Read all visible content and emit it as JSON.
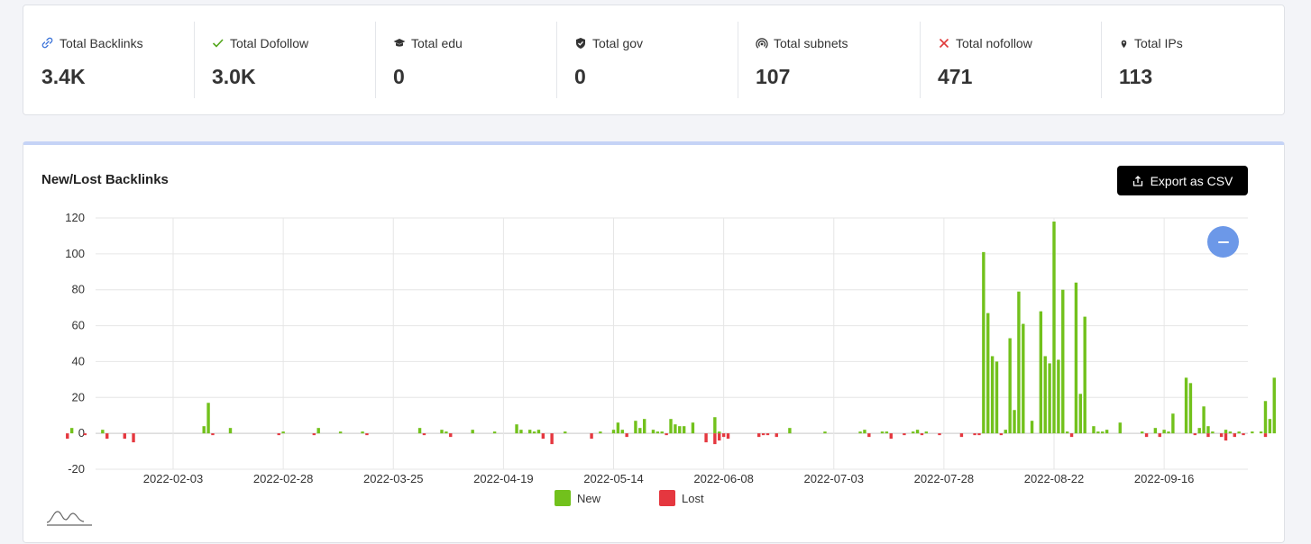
{
  "stats": [
    {
      "label": "Total Backlinks",
      "value": "3.4K",
      "icon": "link-icon",
      "color": "#3a72d8"
    },
    {
      "label": "Total Dofollow",
      "value": "3.0K",
      "icon": "check-icon",
      "color": "#52a61a"
    },
    {
      "label": "Total edu",
      "value": "0",
      "icon": "graduation-cap-icon",
      "color": "#333333"
    },
    {
      "label": "Total gov",
      "value": "0",
      "icon": "shield-check-icon",
      "color": "#333333"
    },
    {
      "label": "Total subnets",
      "value": "107",
      "icon": "broadcast-icon",
      "color": "#333333"
    },
    {
      "label": "Total nofollow",
      "value": "471",
      "icon": "cross-icon",
      "color": "#e03b3b"
    },
    {
      "label": "Total IPs",
      "value": "113",
      "icon": "map-pin-icon",
      "color": "#333333"
    }
  ],
  "chart": {
    "title": "New/Lost Backlinks",
    "export_label": "Export as CSV"
  },
  "chart_data": {
    "type": "bar",
    "title": "New/Lost Backlinks",
    "xlabel": "",
    "ylabel": "",
    "ylim": [
      -20,
      120
    ],
    "yticks": [
      -20,
      0,
      20,
      40,
      60,
      80,
      100,
      120
    ],
    "x_tick_labels": [
      "2022-02-03",
      "2022-02-28",
      "2022-03-25",
      "2022-04-19",
      "2022-05-14",
      "2022-06-08",
      "2022-07-03",
      "2022-07-28",
      "2022-08-22",
      "2022-09-16"
    ],
    "grid": true,
    "legend": "bottom",
    "colors": {
      "new": "#72c11c",
      "lost": "#e5373f"
    },
    "series": [
      {
        "name": "New",
        "values": [
          {
            "x": "2022-01-11",
            "y": 3
          },
          {
            "x": "2022-01-18",
            "y": 2
          },
          {
            "x": "2022-02-10",
            "y": 4
          },
          {
            "x": "2022-02-11",
            "y": 17
          },
          {
            "x": "2022-02-16",
            "y": 3
          },
          {
            "x": "2022-02-28",
            "y": 1
          },
          {
            "x": "2022-03-08",
            "y": 3
          },
          {
            "x": "2022-03-13",
            "y": 1
          },
          {
            "x": "2022-03-18",
            "y": 1
          },
          {
            "x": "2022-03-31",
            "y": 3
          },
          {
            "x": "2022-04-05",
            "y": 2
          },
          {
            "x": "2022-04-06",
            "y": 1
          },
          {
            "x": "2022-04-12",
            "y": 2
          },
          {
            "x": "2022-04-17",
            "y": 1
          },
          {
            "x": "2022-04-22",
            "y": 5
          },
          {
            "x": "2022-04-23",
            "y": 2
          },
          {
            "x": "2022-04-25",
            "y": 2
          },
          {
            "x": "2022-04-26",
            "y": 1
          },
          {
            "x": "2022-04-27",
            "y": 2
          },
          {
            "x": "2022-05-03",
            "y": 1
          },
          {
            "x": "2022-05-11",
            "y": 1
          },
          {
            "x": "2022-05-14",
            "y": 2
          },
          {
            "x": "2022-05-15",
            "y": 6
          },
          {
            "x": "2022-05-16",
            "y": 2
          },
          {
            "x": "2022-05-19",
            "y": 7
          },
          {
            "x": "2022-05-20",
            "y": 3
          },
          {
            "x": "2022-05-21",
            "y": 8
          },
          {
            "x": "2022-05-23",
            "y": 2
          },
          {
            "x": "2022-05-24",
            "y": 1
          },
          {
            "x": "2022-05-25",
            "y": 1
          },
          {
            "x": "2022-05-27",
            "y": 8
          },
          {
            "x": "2022-05-28",
            "y": 5
          },
          {
            "x": "2022-05-29",
            "y": 4
          },
          {
            "x": "2022-05-30",
            "y": 4
          },
          {
            "x": "2022-06-01",
            "y": 6
          },
          {
            "x": "2022-06-06",
            "y": 9
          },
          {
            "x": "2022-06-07",
            "y": 1
          },
          {
            "x": "2022-06-23",
            "y": 3
          },
          {
            "x": "2022-07-01",
            "y": 1
          },
          {
            "x": "2022-07-09",
            "y": 1
          },
          {
            "x": "2022-07-10",
            "y": 2
          },
          {
            "x": "2022-07-14",
            "y": 1
          },
          {
            "x": "2022-07-15",
            "y": 1
          },
          {
            "x": "2022-07-21",
            "y": 1
          },
          {
            "x": "2022-07-22",
            "y": 2
          },
          {
            "x": "2022-07-24",
            "y": 1
          },
          {
            "x": "2022-08-06",
            "y": 101
          },
          {
            "x": "2022-08-07",
            "y": 67
          },
          {
            "x": "2022-08-08",
            "y": 43
          },
          {
            "x": "2022-08-09",
            "y": 40
          },
          {
            "x": "2022-08-11",
            "y": 2
          },
          {
            "x": "2022-08-12",
            "y": 53
          },
          {
            "x": "2022-08-13",
            "y": 13
          },
          {
            "x": "2022-08-14",
            "y": 79
          },
          {
            "x": "2022-08-15",
            "y": 61
          },
          {
            "x": "2022-08-17",
            "y": 7
          },
          {
            "x": "2022-08-19",
            "y": 68
          },
          {
            "x": "2022-08-20",
            "y": 43
          },
          {
            "x": "2022-08-21",
            "y": 39
          },
          {
            "x": "2022-08-22",
            "y": 118
          },
          {
            "x": "2022-08-23",
            "y": 41
          },
          {
            "x": "2022-08-24",
            "y": 80
          },
          {
            "x": "2022-08-25",
            "y": 1
          },
          {
            "x": "2022-08-27",
            "y": 84
          },
          {
            "x": "2022-08-28",
            "y": 22
          },
          {
            "x": "2022-08-29",
            "y": 65
          },
          {
            "x": "2022-08-31",
            "y": 4
          },
          {
            "x": "2022-09-01",
            "y": 1
          },
          {
            "x": "2022-09-02",
            "y": 1
          },
          {
            "x": "2022-09-03",
            "y": 2
          },
          {
            "x": "2022-09-06",
            "y": 6
          },
          {
            "x": "2022-09-11",
            "y": 1
          },
          {
            "x": "2022-09-14",
            "y": 3
          },
          {
            "x": "2022-09-16",
            "y": 2
          },
          {
            "x": "2022-09-17",
            "y": 1
          },
          {
            "x": "2022-09-18",
            "y": 11
          },
          {
            "x": "2022-09-21",
            "y": 31
          },
          {
            "x": "2022-09-22",
            "y": 28
          },
          {
            "x": "2022-09-24",
            "y": 3
          },
          {
            "x": "2022-09-25",
            "y": 15
          },
          {
            "x": "2022-09-26",
            "y": 4
          },
          {
            "x": "2022-09-27",
            "y": 1
          },
          {
            "x": "2022-09-30",
            "y": 2
          },
          {
            "x": "2022-10-01",
            "y": 1
          },
          {
            "x": "2022-10-03",
            "y": 1
          },
          {
            "x": "2022-10-06",
            "y": 1
          },
          {
            "x": "2022-10-08",
            "y": 1
          },
          {
            "x": "2022-10-09",
            "y": 18
          },
          {
            "x": "2022-10-10",
            "y": 8
          },
          {
            "x": "2022-10-11",
            "y": 31
          }
        ]
      },
      {
        "name": "Lost",
        "values": [
          {
            "x": "2022-01-10",
            "y": -3
          },
          {
            "x": "2022-01-14",
            "y": -1
          },
          {
            "x": "2022-01-19",
            "y": -3
          },
          {
            "x": "2022-01-23",
            "y": -3
          },
          {
            "x": "2022-01-25",
            "y": -5
          },
          {
            "x": "2022-02-12",
            "y": -1
          },
          {
            "x": "2022-02-27",
            "y": -1
          },
          {
            "x": "2022-03-07",
            "y": -1
          },
          {
            "x": "2022-03-19",
            "y": -1
          },
          {
            "x": "2022-04-01",
            "y": -1
          },
          {
            "x": "2022-04-07",
            "y": -2
          },
          {
            "x": "2022-04-28",
            "y": -3
          },
          {
            "x": "2022-04-30",
            "y": -6
          },
          {
            "x": "2022-05-09",
            "y": -3
          },
          {
            "x": "2022-05-17",
            "y": -2
          },
          {
            "x": "2022-05-26",
            "y": -1
          },
          {
            "x": "2022-06-04",
            "y": -5
          },
          {
            "x": "2022-06-06",
            "y": -6
          },
          {
            "x": "2022-06-07",
            "y": -4
          },
          {
            "x": "2022-06-08",
            "y": -2
          },
          {
            "x": "2022-06-09",
            "y": -3
          },
          {
            "x": "2022-06-16",
            "y": -2
          },
          {
            "x": "2022-06-17",
            "y": -1
          },
          {
            "x": "2022-06-18",
            "y": -1
          },
          {
            "x": "2022-06-20",
            "y": -2
          },
          {
            "x": "2022-07-11",
            "y": -2
          },
          {
            "x": "2022-07-16",
            "y": -3
          },
          {
            "x": "2022-07-19",
            "y": -1
          },
          {
            "x": "2022-07-23",
            "y": -1
          },
          {
            "x": "2022-07-27",
            "y": -1
          },
          {
            "x": "2022-08-01",
            "y": -2
          },
          {
            "x": "2022-08-04",
            "y": -1
          },
          {
            "x": "2022-08-05",
            "y": -1
          },
          {
            "x": "2022-08-10",
            "y": -1
          },
          {
            "x": "2022-08-26",
            "y": -2
          },
          {
            "x": "2022-09-12",
            "y": -2
          },
          {
            "x": "2022-09-15",
            "y": -2
          },
          {
            "x": "2022-09-23",
            "y": -1
          },
          {
            "x": "2022-09-26",
            "y": -2
          },
          {
            "x": "2022-09-29",
            "y": -2
          },
          {
            "x": "2022-09-30",
            "y": -4
          },
          {
            "x": "2022-10-02",
            "y": -2
          },
          {
            "x": "2022-10-04",
            "y": -1
          },
          {
            "x": "2022-10-09",
            "y": -2
          }
        ]
      }
    ]
  }
}
